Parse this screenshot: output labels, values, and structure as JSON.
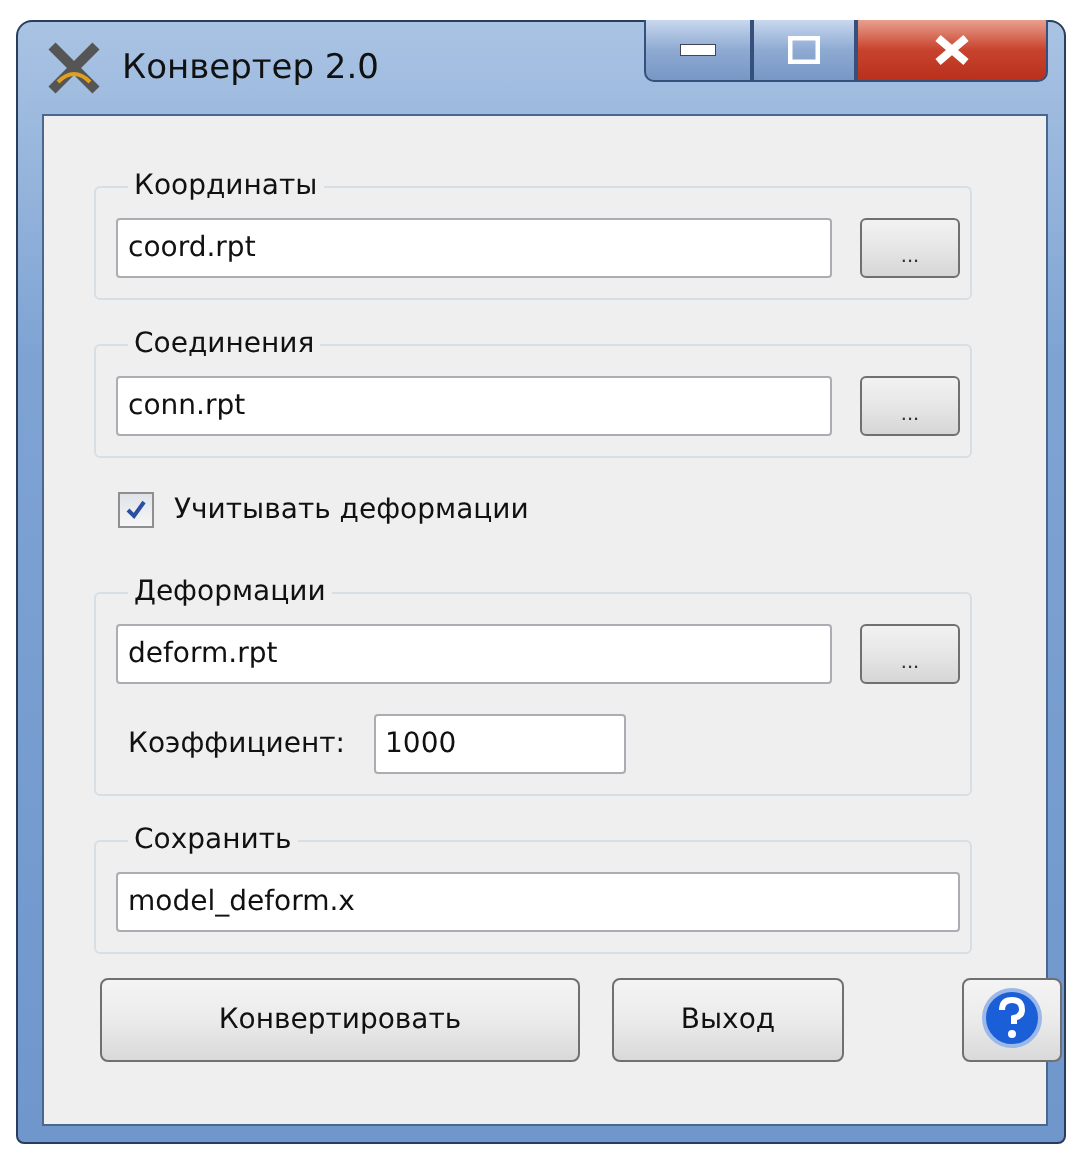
{
  "window": {
    "title": "Конвертер 2.0"
  },
  "sections": [
    {
      "kind": "group",
      "label": "Координаты",
      "value": "coord.rpt",
      "browse": "..."
    },
    {
      "kind": "group",
      "label": "Соединения",
      "value": "conn.rpt",
      "browse": "..."
    },
    {
      "kind": "checkbox",
      "label": "Учитывать деформации",
      "checked": true
    },
    {
      "kind": "group",
      "label": "Деформации",
      "value": "deform.rpt",
      "browse": "...",
      "factor_label": "Коэффициент:",
      "factor_value": "1000"
    },
    {
      "kind": "group",
      "label": "Сохранить",
      "value": "model_deform.x"
    }
  ],
  "buttons": [
    {
      "label": "Конвертировать"
    },
    {
      "label": "Выход"
    }
  ]
}
